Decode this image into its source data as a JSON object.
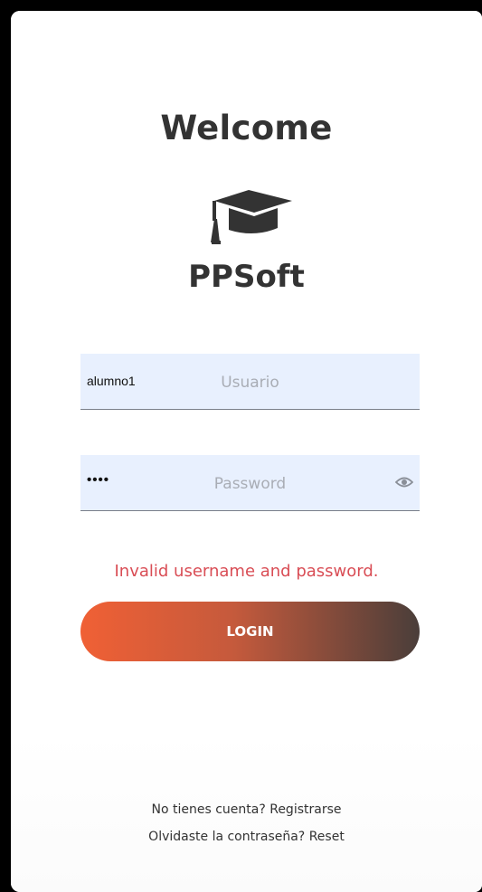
{
  "header": {
    "title": "Welcome",
    "brand": "PPSoft",
    "logo_icon": "graduation-cap-icon"
  },
  "form": {
    "username": {
      "value": "alumno1",
      "placeholder": "Usuario"
    },
    "password": {
      "value": "••••",
      "placeholder": "Password",
      "toggle_icon": "eye-icon"
    },
    "error": "Invalid username and password.",
    "login_label": "LOGIN"
  },
  "footer": {
    "signup_prompt": "No tienes cuenta?",
    "signup_link": "Registrarse",
    "reset_prompt": "Olvidaste la contraseña?",
    "reset_link": "Reset"
  },
  "colors": {
    "page_background": "#000000",
    "card_background": "#ffffff",
    "text_dark": "#333333",
    "field_background": "#e8f0fe",
    "placeholder": "#a9adb5",
    "error": "#d94d55",
    "button_gradient_start": "#f06035",
    "button_gradient_end": "#4a3e3a"
  }
}
